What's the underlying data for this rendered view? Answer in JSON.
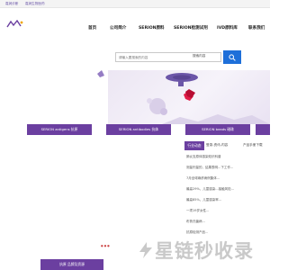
{
  "topbar": {
    "left_link": "嘉润诊断",
    "right_link": "嘉润生物医药"
  },
  "nav": {
    "items": [
      "首页",
      "公司简介",
      "SERION原料",
      "SERION检测试剂",
      "IVD原料库",
      "联系我们"
    ]
  },
  "search": {
    "placeholder": "请输入要搜索的内容",
    "select_label": "搜索内容"
  },
  "tabs": [
    "SERION antigens 抗原",
    "SERION antibodies 抗体",
    "SERION beads 磁珠"
  ],
  "sidebar": {
    "active_tab": "行业动态",
    "tabs_label": "登录-资讯-内容",
    "tabs_right": "产品手册下载"
  },
  "news": [
    "肺炎支原体感染知识科普",
    "测量剂量的，结果表明...下工作...",
    "7月全球麻疹病例集体...",
    "最高29%，儿童感染...接触风险...",
    "最高85%，儿童感染率...",
    "一项19岁女性...",
    "布鲁氏菌病...",
    "抗原检测产品..."
  ],
  "footer": {
    "purple_label": "抗原 品牌及资源"
  },
  "watermark": "星链秒收录",
  "colors": {
    "brand_purple": "#6b3fa0",
    "search_blue": "#1e6fd9"
  }
}
